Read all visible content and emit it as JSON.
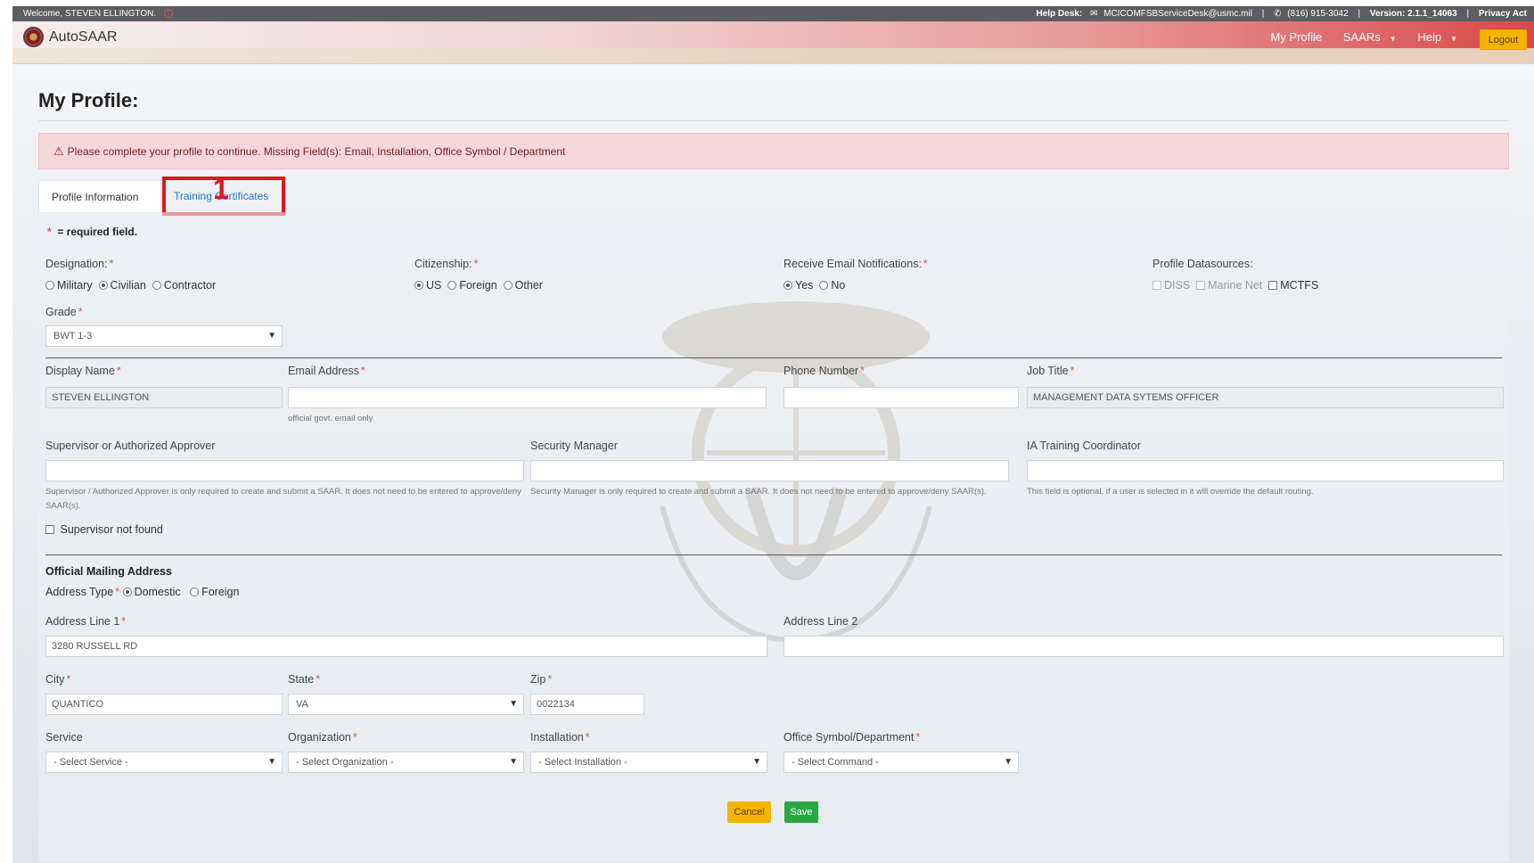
{
  "topbar": {
    "welcome": "Welcome, STEVEN ELLINGTON.",
    "help_desk_label": "Help Desk:",
    "email": "MCICOMFSBServiceDesk@usmc.mil",
    "phone": "(816) 915-3042",
    "version": "Version: 2.1.1_14063",
    "privacy": "Privacy Act"
  },
  "navbar": {
    "brand": "AutoSAAR",
    "my_profile": "My Profile",
    "saars": "SAARs",
    "help": "Help",
    "logout": "Logout"
  },
  "page": {
    "title": "My Profile:",
    "alert": "Please complete your profile to continue. Missing Field(s): Email, Installation, Office Symbol / Department",
    "tabs": [
      "Profile Information",
      "Training Certificates"
    ],
    "annotation_number": "1",
    "required_note": "= required field."
  },
  "form": {
    "designation": {
      "label": "Designation:",
      "options": [
        "Military",
        "Civilian",
        "Contractor"
      ],
      "selected": "Civilian"
    },
    "citizenship": {
      "label": "Citizenship:",
      "options": [
        "US",
        "Foreign",
        "Other"
      ],
      "selected": "US"
    },
    "email_notifications": {
      "label": "Receive Email Notifications:",
      "options": [
        "Yes",
        "No"
      ],
      "selected": "Yes"
    },
    "datasources": {
      "label": "Profile Datasources:",
      "options": [
        "DISS",
        "Marine Net",
        "MCTFS"
      ]
    },
    "grade": {
      "label": "Grade",
      "value": "BWT 1-3"
    },
    "display_name": {
      "label": "Display Name",
      "value": "STEVEN ELLINGTON"
    },
    "email": {
      "label": "Email Address",
      "value": "",
      "help": "official govt. email only"
    },
    "phone": {
      "label": "Phone Number",
      "value": ""
    },
    "job_title": {
      "label": "Job Title",
      "value": "MANAGEMENT DATA SYTEMS OFFICER"
    },
    "supervisor": {
      "label": "Supervisor or Authorized Approver",
      "value": "",
      "help": "Supervisor / Authorized Approver is only required to create and submit a SAAR. It does not need to be entered to approve/deny SAAR(s)."
    },
    "security_manager": {
      "label": "Security Manager",
      "value": "",
      "help": "Security Manager is only required to create and submit a SAAR. It does not need to be entered to approve/deny SAAR(s)."
    },
    "ia_coordinator": {
      "label": "IA Training Coordinator",
      "value": "",
      "help": "This field is optional, if a user is selected in it will override the default routing."
    },
    "supervisor_not_found": "Supervisor not found",
    "mailing": {
      "heading": "Official Mailing Address",
      "address_type_label": "Address Type",
      "address_types": [
        "Domestic",
        "Foreign"
      ],
      "selected": "Domestic",
      "line1": {
        "label": "Address Line 1",
        "value": "3280 RUSSELL RD"
      },
      "line2": {
        "label": "Address Line 2",
        "value": ""
      },
      "city": {
        "label": "City",
        "value": "QUANTICO"
      },
      "state": {
        "label": "State",
        "value": "VA"
      },
      "zip": {
        "label": "Zip",
        "value": "0022134"
      }
    },
    "service": {
      "label": "Service",
      "value": "- Select Service -"
    },
    "organization": {
      "label": "Organization",
      "value": "- Select Organization -"
    },
    "installation": {
      "label": "Installation",
      "value": "- Select Installation -"
    },
    "office_symbol": {
      "label": "Office Symbol/Department",
      "value": "- Select Command -"
    },
    "cancel": "Cancel",
    "save": "Save"
  }
}
